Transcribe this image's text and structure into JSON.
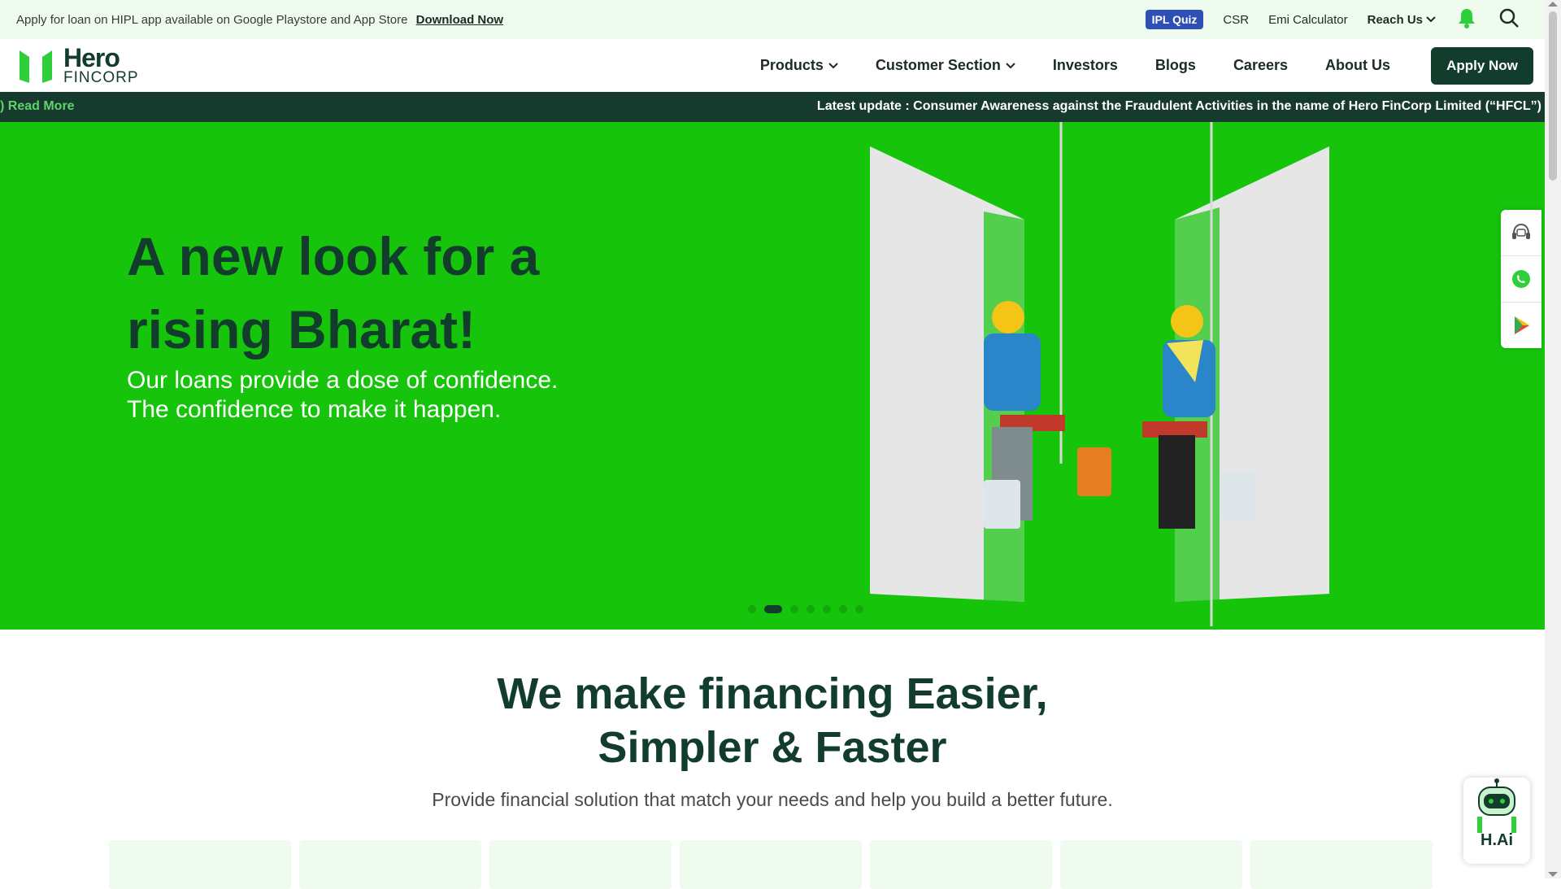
{
  "topbar": {
    "message": "Apply for loan on HIPL app available on Google Playstore and App Store",
    "download_link": "Download Now",
    "ipl_quiz": "IPL Quiz",
    "csr": "CSR",
    "emi_calculator": "Emi Calculator",
    "reach_us": "Reach Us"
  },
  "header": {
    "logo_word1": "Hero",
    "logo_word2": "FINCORP",
    "nav": {
      "products": "Products",
      "customer_section": "Customer Section",
      "investors": "Investors",
      "blogs": "Blogs",
      "careers": "Careers",
      "about_us": "About Us"
    },
    "apply_now": "Apply Now"
  },
  "ticker": {
    "read_more": ") Read More",
    "update": "Latest update : Consumer Awareness against the Fraudulent Activities in the name of Hero FinCorp Limited (“HFCL”)"
  },
  "hero": {
    "title": "A new look for a rising Bharat!",
    "subtitle_line1": "Our loans provide a dose of confidence.",
    "subtitle_line2": "The confidence to make it happen.",
    "slide_count": 7,
    "active_slide": 2
  },
  "intro": {
    "title_line1": "We make financing Easier,",
    "title_line2": "Simpler & Faster",
    "subtitle": "Provide financial solution that match your needs and help you build a better future."
  },
  "chatbot": {
    "label": "H.Ai"
  },
  "float_icons": [
    "support-agent-icon",
    "whatsapp-icon",
    "play-store-icon"
  ],
  "colors": {
    "brand_dark": "#123d2c",
    "brand_green": "#16c40c",
    "ticker_bg": "#173a2e",
    "topbar_bg": "#f0fbf0",
    "ipl_blue": "#2f4fb4"
  }
}
